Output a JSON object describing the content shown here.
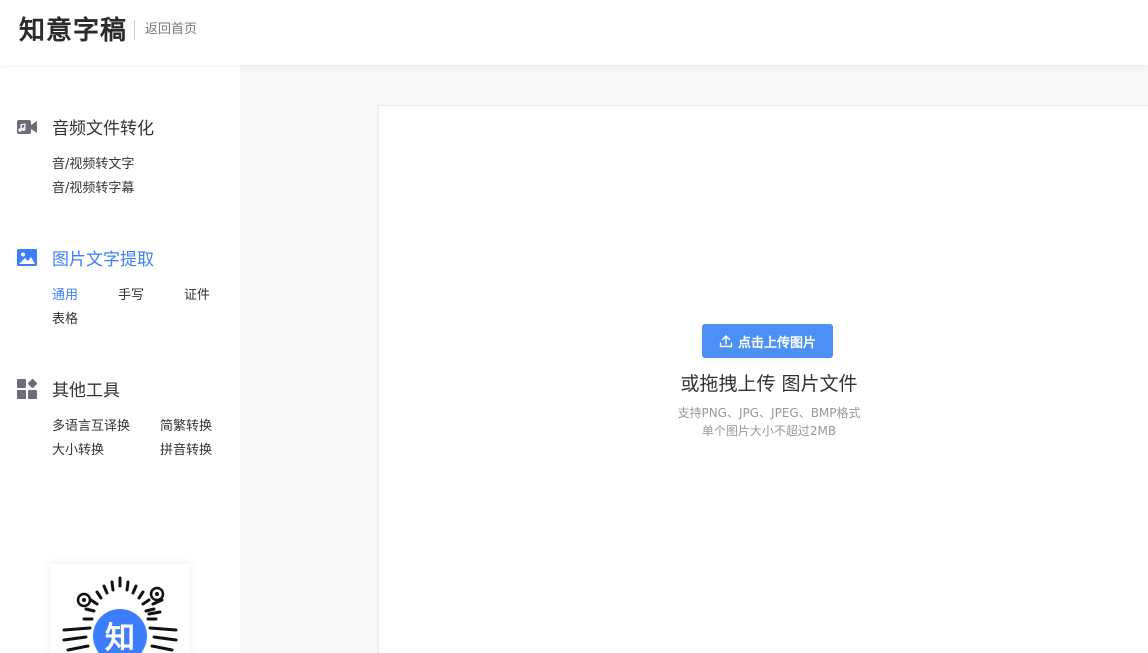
{
  "header": {
    "logo": "知意字稿",
    "back_link": "返回首页"
  },
  "sidebar": {
    "sections": [
      {
        "title": "音频文件转化",
        "icon": "video-camera-icon",
        "links": [
          "音/视频转文字",
          "音/视频转字幕"
        ]
      },
      {
        "title": "图片文字提取",
        "icon": "image-icon",
        "active": true,
        "links": [
          "通用",
          "手写",
          "证件",
          "表格"
        ]
      },
      {
        "title": "其他工具",
        "icon": "apps-icon",
        "links": [
          "多语言互译换",
          "简繁转换",
          "大小转换",
          "拼音转换"
        ]
      }
    ],
    "qr_logo_text": "知"
  },
  "upload": {
    "button_label": "点击上传图片",
    "drop_text": "或拖拽上传 图片文件",
    "hint_formats": "支持PNG、JPG、JPEG、BMP格式",
    "hint_size": "单个图片大小不超过2MB"
  },
  "colors": {
    "accent": "#3d7eff",
    "button": "#4a90f5"
  }
}
